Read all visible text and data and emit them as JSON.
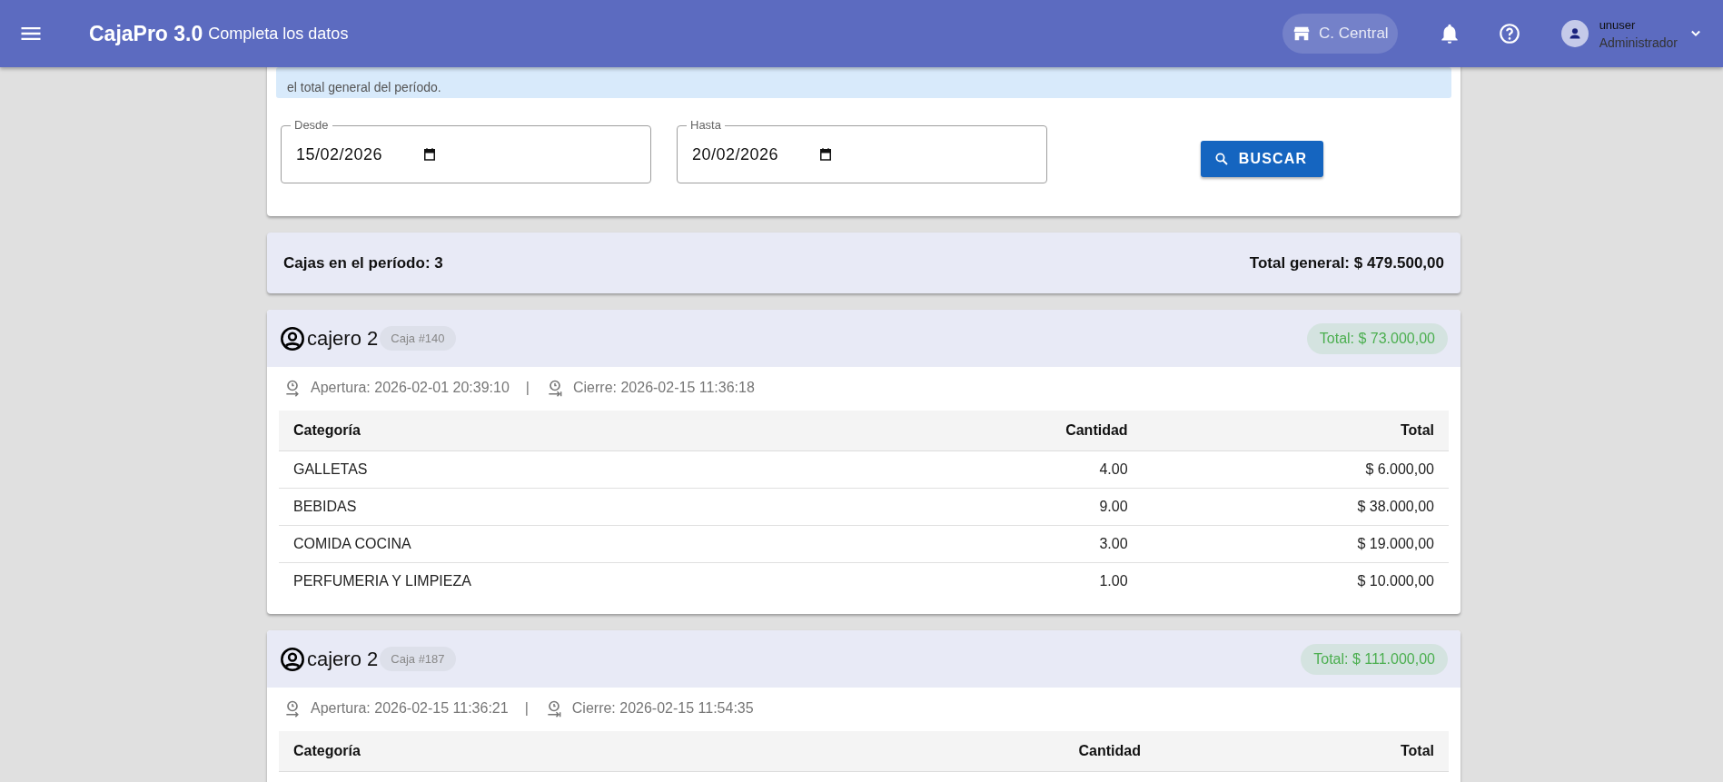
{
  "app_bar": {
    "brand": "CajaPro 3.0",
    "subtitle": "Completa los datos",
    "branch": "C. Central",
    "user": {
      "name": "unuser",
      "role": "Administrador"
    }
  },
  "info": {
    "text": "el total general del período."
  },
  "filters": {
    "fields": [
      {
        "label": "Desde",
        "value": "15/02/2026"
      },
      {
        "label": "Hasta",
        "value": "20/02/2026"
      }
    ],
    "button": "BUSCAR"
  },
  "summary": {
    "count": "Cajas en el período: 3",
    "total": "Total general: $ 479.500,00"
  },
  "cajas": [
    {
      "cashier": "cajero 2",
      "box": "Caja #140",
      "total": "Total: $ 73.000,00",
      "opening": "Apertura: 2026-02-01 20:39:10",
      "separator": "|",
      "closing": "Cierre: 2026-02-15 11:36:18",
      "columns": [
        "Categoría",
        "Cantidad",
        "Total"
      ],
      "rows": [
        {
          "category": "GALLETAS",
          "quantity": "4.00",
          "total": "$ 6.000,00"
        },
        {
          "category": "BEBIDAS",
          "quantity": "9.00",
          "total": "$ 38.000,00"
        },
        {
          "category": "COMIDA COCINA",
          "quantity": "3.00",
          "total": "$ 19.000,00"
        },
        {
          "category": "PERFUMERIA Y LIMPIEZA",
          "quantity": "1.00",
          "total": "$ 10.000,00"
        }
      ]
    },
    {
      "cashier": "cajero 2",
      "box": "Caja #187",
      "total": "Total: $ 111.000,00",
      "opening": "Apertura: 2026-02-15 11:36:21",
      "separator": "|",
      "closing": "Cierre: 2026-02-15 11:54:35",
      "columns": [
        "Categoría",
        "Cantidad",
        "Total"
      ]
    }
  ]
}
